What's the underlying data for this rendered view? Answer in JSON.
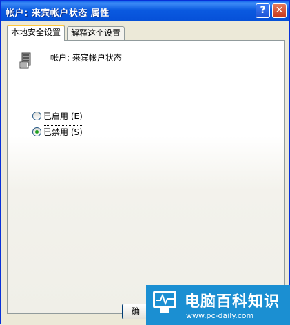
{
  "window": {
    "title": "帐户: 来宾帐户状态 属性"
  },
  "titlebar": {
    "help_label": "?",
    "close_label": "✕"
  },
  "tabs": [
    {
      "label": "本地安全设置",
      "active": true
    },
    {
      "label": "解释这个设置",
      "active": false
    }
  ],
  "policy": {
    "title": "帐户: 来宾帐户状态",
    "icon": "policy-server-icon"
  },
  "options": [
    {
      "label": "已启用 (E)",
      "checked": false
    },
    {
      "label": "已禁用 (S)",
      "checked": true
    }
  ],
  "buttons": {
    "ok_label": "确"
  },
  "watermark": {
    "main": "电脑百科知识",
    "url": "www.pc-daily.com"
  },
  "colors": {
    "title_bar": "#0A5AE0",
    "active_tab_accent": "#FFC83C",
    "radio_dot": "#21A121",
    "logo_bg": "#1B8FD2"
  }
}
